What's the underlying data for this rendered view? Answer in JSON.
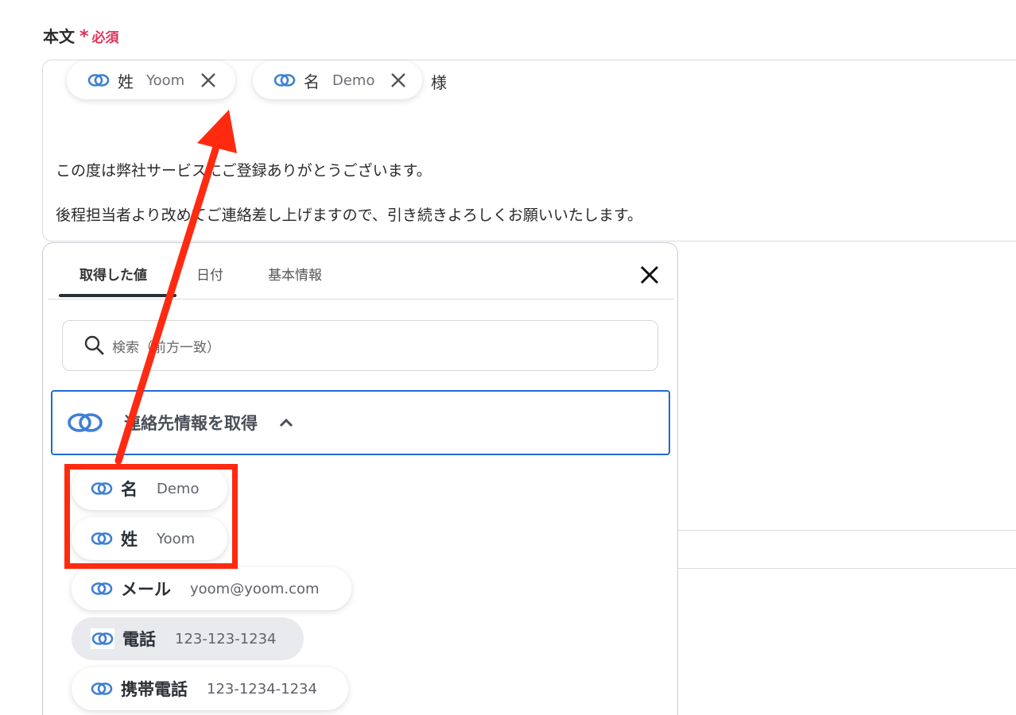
{
  "form": {
    "label": "本文",
    "required_mark": "*",
    "required_text": "必須"
  },
  "editor": {
    "pills": [
      {
        "name": "姓",
        "value": "Yoom"
      },
      {
        "name": "名",
        "value": "Demo"
      }
    ],
    "suffix": "様",
    "lines": [
      "この度は弊社サービスにご登録ありがとうございます。",
      "後程担当者より改めてご連絡差し上げますので、引き続きよろしくお願いいたします。"
    ]
  },
  "popup": {
    "tabs": [
      "取得した値",
      "日付",
      "基本情報"
    ],
    "active_tab": "取得した値",
    "search_placeholder": "検索（前方一致）",
    "group_title": "連絡先情報を取得",
    "items": [
      {
        "name": "名",
        "value": "Demo"
      },
      {
        "name": "姓",
        "value": "Yoom"
      },
      {
        "name": "メール",
        "value": "yoom@yoom.com"
      },
      {
        "name": "電話",
        "value": "123-123-1234"
      },
      {
        "name": "携帯電話",
        "value": "123-1234-1234"
      }
    ]
  },
  "colors": {
    "required": "#e0335a",
    "accent_blue": "#1f6cd1",
    "annotation_red": "#ff2a10"
  },
  "icons": [
    "link-chain-icon",
    "close-icon",
    "search-icon",
    "chevron-up-icon"
  ]
}
